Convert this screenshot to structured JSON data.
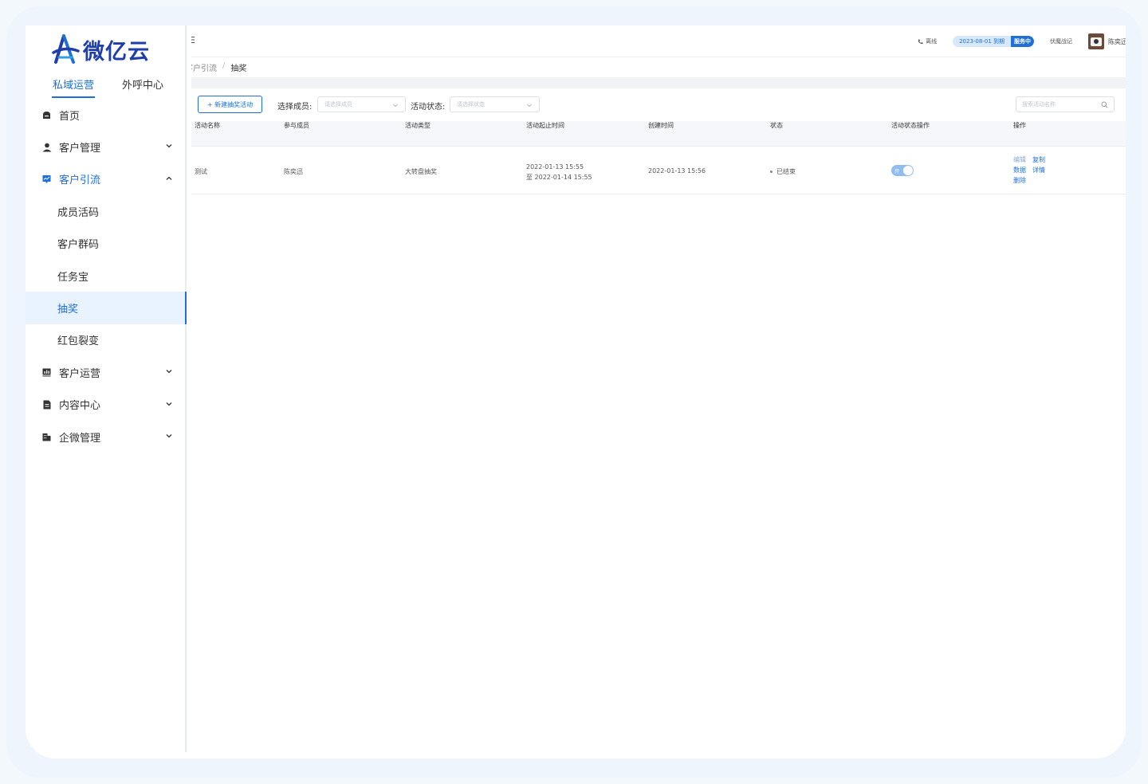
{
  "brand": {
    "name": "微亿云",
    "color": "#1f3ea8",
    "accent": "#1e6fd8"
  },
  "top_tabs": [
    {
      "label": "私域运营",
      "active": true
    },
    {
      "label": "外呼中心",
      "active": false
    }
  ],
  "nav": {
    "home": "首页",
    "customer_mgmt": "客户管理",
    "customer_traffic": "客户引流",
    "sub": {
      "member_qr": "成员活码",
      "group_qr": "客户群码",
      "task": "任务宝",
      "lottery": "抽奖",
      "red_packet": "红包裂变"
    },
    "customer_ops": "客户运营",
    "content_center": "内容中心",
    "wecom_mgmt": "企微管理"
  },
  "topbar": {
    "phone_status": "离线",
    "expire": "2023-08-01 到期",
    "service": "服务中",
    "org": "伏魔战记",
    "username": "陈奕迅"
  },
  "breadcrumb": {
    "parent": "客户引流",
    "sep": "/",
    "current": "抽奖"
  },
  "toolbar": {
    "new_button": "+ 新建抽奖活动",
    "member_label": "选择成员:",
    "member_placeholder": "请选择成员",
    "status_label": "活动状态:",
    "status_placeholder": "请选择状态",
    "search_placeholder": "搜索活动名称"
  },
  "table": {
    "headers": {
      "name": "活动名称",
      "members": "参与成员",
      "type": "活动类型",
      "period": "活动起止时间",
      "created": "创建时间",
      "status": "状态",
      "status_op": "活动状态操作",
      "ops": "操作"
    },
    "rows": [
      {
        "name": "测试",
        "members": "陈奕迅",
        "type": "大转盘抽奖",
        "period_start": "2022-01-13 15:55",
        "period_end": "至 2022-01-14 15:55",
        "created": "2022-01-13 15:56",
        "status": "已结束",
        "toggle_label": "开",
        "ops": {
          "edit": "编辑",
          "copy": "复制",
          "data": "数据",
          "detail": "详情",
          "delete": "删除"
        }
      }
    ]
  }
}
